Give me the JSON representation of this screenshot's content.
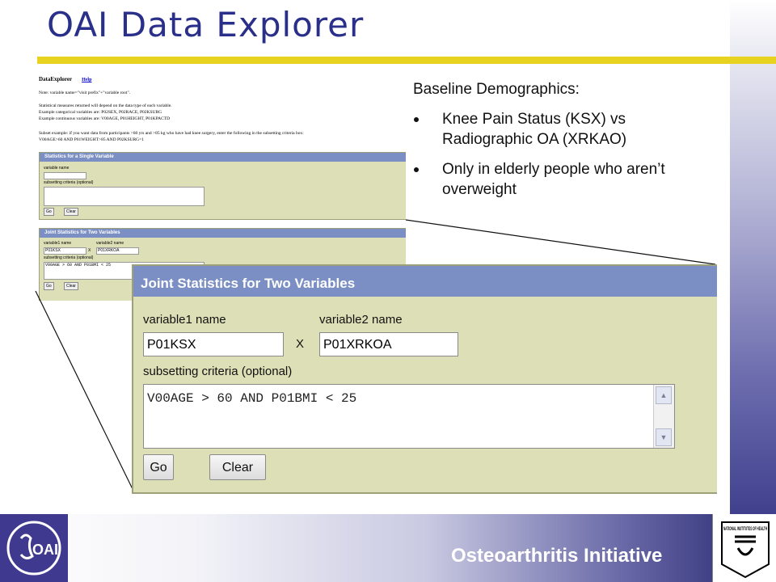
{
  "slide": {
    "title": "OAI Data Explorer",
    "footer": "Osteoarthritis Initiative",
    "colors": {
      "title": "#2a2f8a",
      "rule": "#e6d21f",
      "panel_header": "#7b8fc4",
      "panel_bg": "#dde0b6"
    }
  },
  "notes": {
    "heading": "Baseline Demographics:",
    "bullets": [
      "Knee Pain Status (KSX) vs Radiographic OA (XRKAO)",
      "Only in elderly people who aren’t overweight"
    ]
  },
  "mini": {
    "app_title": "DataExplorer",
    "help_link": "Help",
    "lines": [
      "Note: variable name=\"visit prefix\"+\"variable root\".",
      "Statistical measures returned will depend on the data type of each variable.",
      "Example categorical variables are: P02SEX, P02RACE, P02KSURG",
      "Example continuous variables are: V00AGE, P01HEIGHT, P01KPACTD",
      "Subset example: if you want data from participants >60 yrs and >85 kg who have had knee surgery, enter the following in the subsetting criteria box:",
      "V00AGE>60 AND P01WEIGHT>85 AND P02KSURG=1"
    ],
    "single": {
      "header": "Statistics for a Single Variable",
      "var_label": "variable name",
      "criteria_label": "subsetting criteria (optional)",
      "go": "Go",
      "clear": "Clear"
    },
    "joint": {
      "header": "Joint Statistics for Two Variables",
      "var1_label": "variable1 name",
      "var2_label": "variable2 name",
      "var1_value": "P01KSX",
      "x": "X",
      "var2_value": "P01XRKOA",
      "criteria_label": "subsetting criteria (optional)",
      "criteria_value": "V00AGE > 60 AND P01BMI < 25",
      "go": "Go",
      "clear": "Clear"
    }
  },
  "zoom": {
    "header": "Joint Statistics for Two Variables",
    "var1_label": "variable1 name",
    "var2_label": "variable2 name",
    "var1_value": "P01KSX",
    "x": "X",
    "var2_value": "P01XRKOA",
    "criteria_label": "subsetting criteria (optional)",
    "criteria_value": "V00AGE > 60 AND P01BMI < 25",
    "go": "Go",
    "clear": "Clear"
  },
  "logos": {
    "left": {
      "name": "oai-logo",
      "text": "OAI"
    },
    "right": {
      "name": "nih-seal",
      "text": "NATIONAL INSTITUTES OF HEALTH"
    }
  }
}
